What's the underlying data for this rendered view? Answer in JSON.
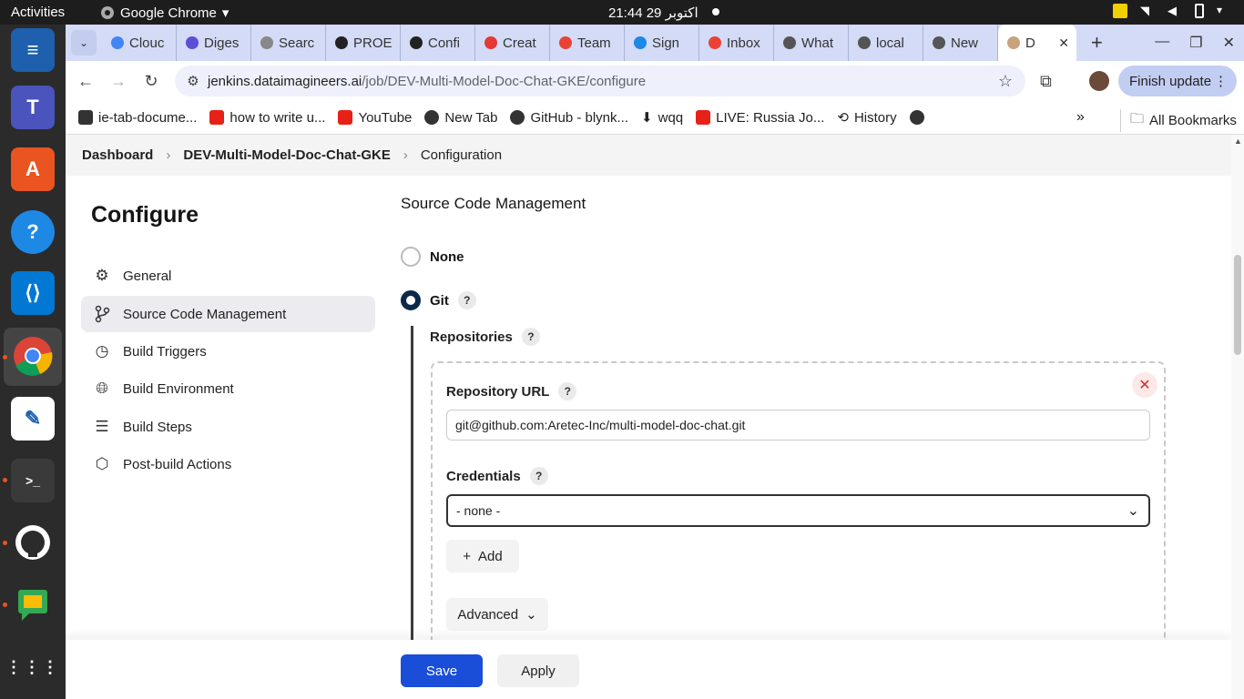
{
  "system": {
    "activities": "Activities",
    "app_name": "Google Chrome",
    "clock": "اکتوبر 29  21:44"
  },
  "dock": {
    "items": [
      "text-editor-icon",
      "teams-linux-icon",
      "app-store-icon",
      "help-icon",
      "vscode-icon",
      "chrome-icon",
      "notes-icon",
      "terminal-icon",
      "github-icon",
      "google-chat-icon",
      "app-grid-icon"
    ]
  },
  "browser": {
    "tabs": [
      {
        "label": "Clouc",
        "color": "#4285f4"
      },
      {
        "label": "Diges",
        "color": "#5b4fd6"
      },
      {
        "label": "Searc",
        "color": "#888888"
      },
      {
        "label": "PROE",
        "color": "#222222"
      },
      {
        "label": "Confi",
        "color": "#222222"
      },
      {
        "label": "Creat",
        "color": "#e53935"
      },
      {
        "label": "Team",
        "color": "#ea4335"
      },
      {
        "label": "Sign",
        "color": "#1e88e5"
      },
      {
        "label": "Inbox",
        "color": "#ea4335"
      },
      {
        "label": "What",
        "color": "#555555"
      },
      {
        "label": "local",
        "color": "#555555"
      },
      {
        "label": "New",
        "color": "#555555"
      },
      {
        "label": "D",
        "color": "#c8a27a"
      }
    ],
    "url_host": "jenkins.dataimagineers.ai",
    "url_path": "/job/DEV-Multi-Model-Doc-Chat-GKE/configure",
    "finish_update": "Finish update",
    "bookmarks": [
      {
        "label": "ie-tab-docume...",
        "color": "#333333"
      },
      {
        "label": "how to write u...",
        "color": "#e62117"
      },
      {
        "label": "YouTube",
        "color": "#e62117"
      },
      {
        "label": "New Tab",
        "color": "#333333"
      },
      {
        "label": "GitHub - blynk...",
        "color": "#333333"
      },
      {
        "label": "wqq",
        "color": "#333333"
      },
      {
        "label": "LIVE: Russia Jo...",
        "color": "#e62117"
      },
      {
        "label": "History",
        "color": "#333333"
      },
      {
        "label": "",
        "color": "#333333"
      }
    ],
    "all_bookmarks": "All Bookmarks"
  },
  "breadcrumb": {
    "dashboard": "Dashboard",
    "job": "DEV-Multi-Model-Doc-Chat-GKE",
    "current": "Configuration"
  },
  "sidebar": {
    "title": "Configure",
    "items": [
      {
        "label": "General",
        "icon": "gear-icon",
        "active": false
      },
      {
        "label": "Source Code Management",
        "icon": "branch-icon",
        "active": true
      },
      {
        "label": "Build Triggers",
        "icon": "clock-icon",
        "active": false
      },
      {
        "label": "Build Environment",
        "icon": "globe-icon",
        "active": false
      },
      {
        "label": "Build Steps",
        "icon": "list-icon",
        "active": false
      },
      {
        "label": "Post-build Actions",
        "icon": "package-icon",
        "active": false
      }
    ]
  },
  "scm": {
    "title": "Source Code Management",
    "none_label": "None",
    "git_label": "Git",
    "repositories_label": "Repositories",
    "repo_url_label": "Repository URL",
    "repo_url_value": "git@github.com:Aretec-Inc/multi-model-doc-chat.git",
    "credentials_label": "Credentials",
    "credentials_value": "- none -",
    "add_label": "Add",
    "advanced_label": "Advanced",
    "help": "?"
  },
  "actions": {
    "save": "Save",
    "apply": "Apply"
  },
  "colors": {
    "save_button": "#1a4ed8",
    "radio_selected": "#0b2a49",
    "chrome_frame": "#d3dbf7"
  }
}
